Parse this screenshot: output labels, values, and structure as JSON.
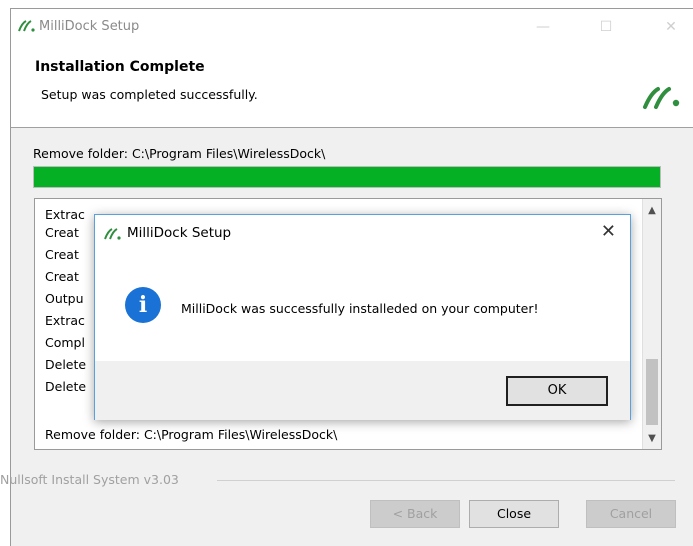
{
  "window": {
    "title": "MilliDock Setup",
    "header_title": "Installation Complete",
    "header_subtitle": "Setup was completed successfully."
  },
  "status_text": "Remove folder: C:\\Program Files\\WirelessDock\\",
  "progress": 1.0,
  "log_lines": [
    "Extrac",
    "Creat",
    "Creat",
    "Creat",
    "Outpu",
    "Extrac",
    "Compl",
    "Delete",
    "Delete",
    "Remove folder: C:\\Program Files\\WirelessDock\\"
  ],
  "footer_text": "Nullsoft Install System v3.03",
  "buttons": {
    "back": "< Back",
    "close": "Close",
    "cancel": "Cancel"
  },
  "dialog": {
    "title": "MilliDock Setup",
    "message": "MilliDock was successfully installeded on your computer!",
    "ok": "OK",
    "close_glyph": "✕",
    "info_glyph": "i"
  },
  "colors": {
    "progress": "#06b025",
    "brand": "#2f8f3f",
    "info": "#1a71d6"
  },
  "icons": [
    "millidock-logo-icon",
    "minimize-icon",
    "maximize-icon",
    "close-icon",
    "info-icon",
    "scroll-up-icon",
    "scroll-down-icon"
  ]
}
